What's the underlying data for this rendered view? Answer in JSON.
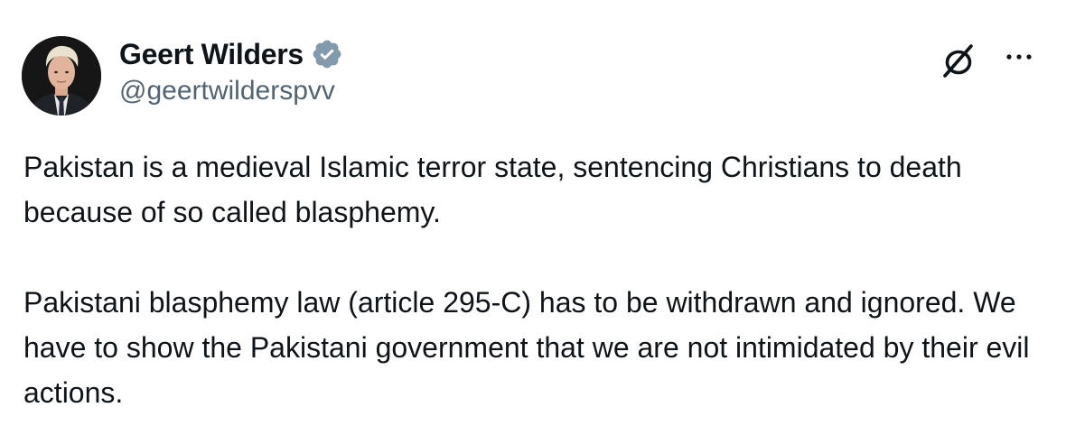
{
  "author": {
    "display_name": "Geert Wilders",
    "handle": "@geertwilderspvv",
    "verified": true,
    "verified_color": "#829aab",
    "avatar_icon": "profile-photo"
  },
  "actions": {
    "grok_icon": "grok-icon",
    "more_icon": "more-options-icon"
  },
  "post": {
    "paragraphs": [
      "Pakistan is a medieval Islamic terror state, sentencing Christians to death because of so called blasphemy.",
      "Pakistani blasphemy law (article 295-C) has to be withdrawn and ignored. We have to show the Pakistani government that we are not intimidated by their evil actions."
    ]
  },
  "colors": {
    "text_primary": "#0f1419",
    "text_secondary": "#536471",
    "background": "#ffffff"
  }
}
